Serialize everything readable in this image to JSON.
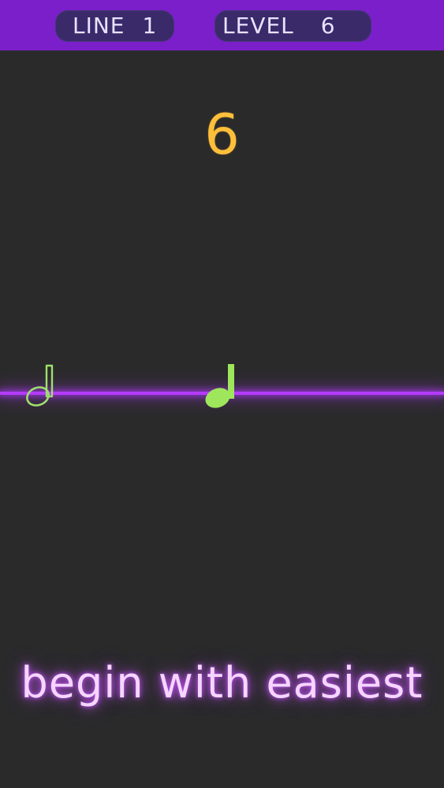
{
  "header": {
    "line_label": "LINE",
    "line_value": "1",
    "level_label": "LEVEL",
    "level_value": "6"
  },
  "main": {
    "big_number": "6"
  },
  "notes": [
    {
      "type": "half-note-outline",
      "color": "#9de06a"
    },
    {
      "type": "quarter-note-filled",
      "color": "#9ee65b"
    }
  ],
  "footer": {
    "hint_text": "begin with easiest"
  },
  "colors": {
    "background": "#2a2a2b",
    "header": "#7a1fc9",
    "pill": "#3a2a6a",
    "number": "#ffbf3a",
    "neon_line": "#b43bff",
    "hint_glow": "#c953ff"
  }
}
